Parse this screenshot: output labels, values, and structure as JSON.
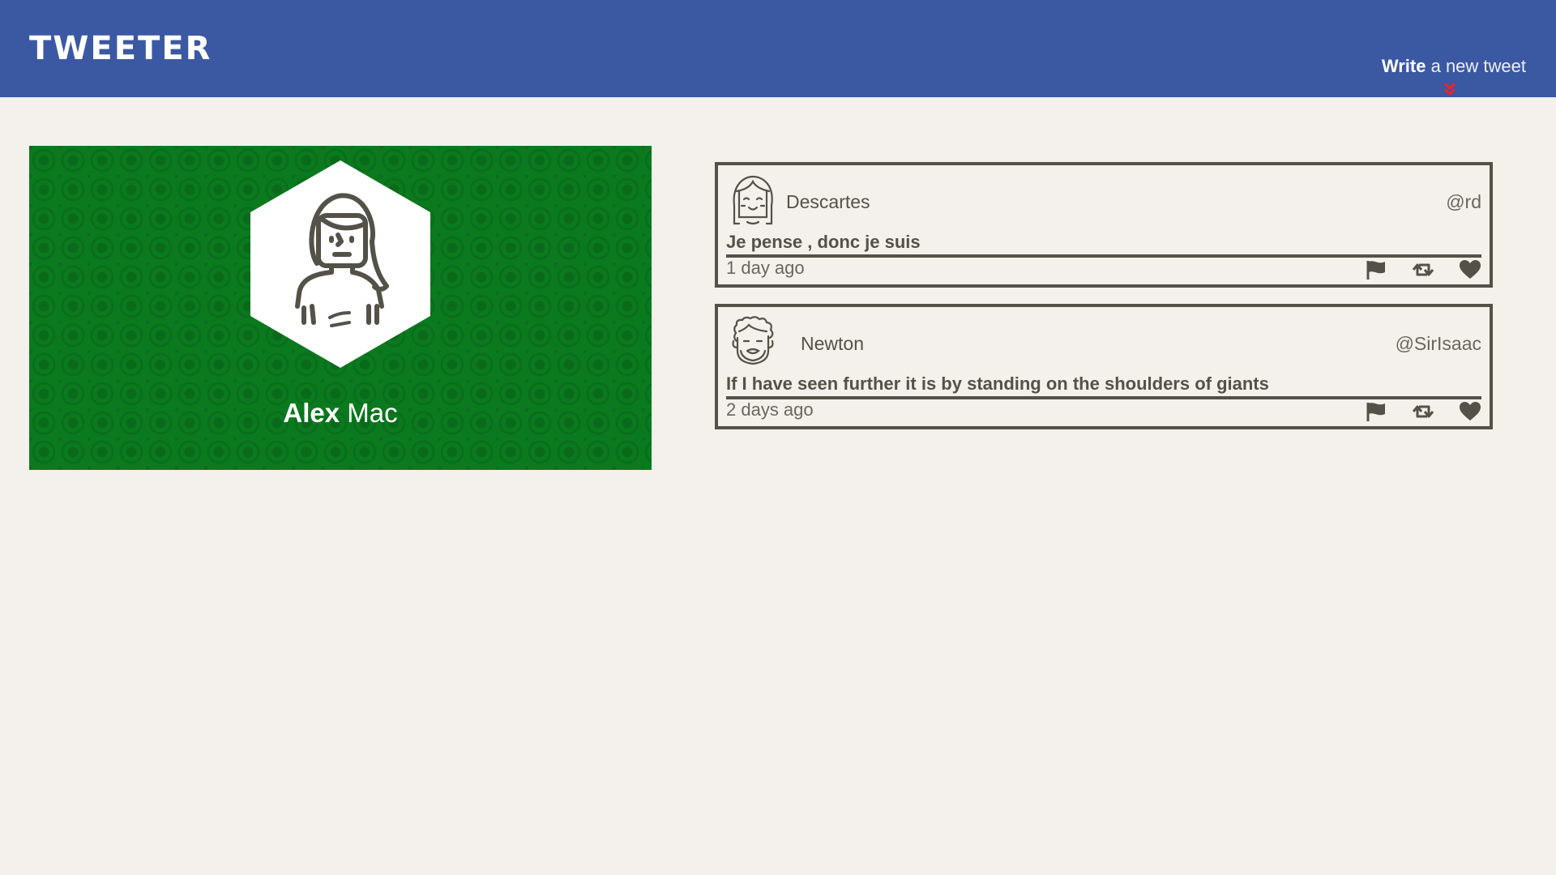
{
  "navbar": {
    "brand": "TWEETER",
    "compose": {
      "bold": "Write",
      "rest": " a new tweet"
    }
  },
  "profile": {
    "first_name": "Alex",
    "last_name": " Mac",
    "avatar_icon": "woman-avatar-icon"
  },
  "tweets": [
    {
      "name": "Descartes",
      "handle": "@rd",
      "text": "Je pense , donc je suis",
      "time": "1 day ago",
      "avatar_icon": "girl-face-avatar-icon"
    },
    {
      "name": "Newton",
      "handle": "@SirIsaac",
      "text": "If I have seen further it is by standing on the shoulders of giants",
      "time": "2 days ago",
      "avatar_icon": "curly-hair-avatar-icon"
    }
  ],
  "actions": [
    "flag-icon",
    "retweet-icon",
    "heart-icon"
  ],
  "colors": {
    "navbar": "#3b58a2",
    "background": "#f4f1ec",
    "profile": "#0b7a1f",
    "text": "#545149",
    "accent": "#e8232b"
  }
}
